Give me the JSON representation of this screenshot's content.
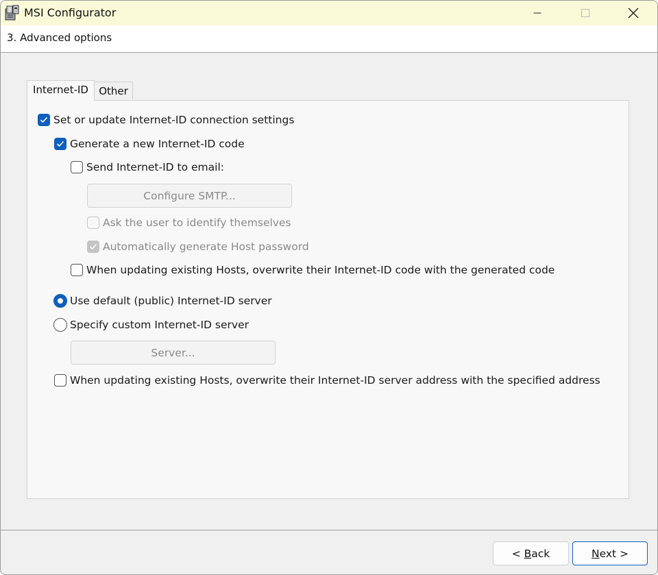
{
  "window": {
    "title": "MSI Configurator",
    "icon": "installer-box-icon"
  },
  "header": {
    "step_title": "3. Advanced options"
  },
  "tabs": [
    {
      "label": "Internet-ID",
      "active": true
    },
    {
      "label": "Other",
      "active": false
    }
  ],
  "internet_id": {
    "set_or_update": {
      "label": "Set or update Internet-ID connection settings",
      "checked": true
    },
    "generate_code": {
      "label": "Generate a new Internet-ID code",
      "checked": true
    },
    "send_email": {
      "label": "Send Internet-ID to email:",
      "checked": false
    },
    "configure_smtp": {
      "label": "Configure SMTP...",
      "enabled": false
    },
    "ask_identify": {
      "label": "Ask the user to identify themselves",
      "checked": false,
      "enabled": false
    },
    "auto_password": {
      "label": "Automatically generate Host password",
      "checked": true,
      "enabled": false
    },
    "overwrite_code": {
      "label": "When updating existing Hosts, overwrite their Internet-ID code with the generated code",
      "checked": false
    },
    "server_mode": {
      "default_label": "Use default (public) Internet-ID server",
      "custom_label": "Specify custom Internet-ID server",
      "selected": "default"
    },
    "server_button": {
      "label": "Server...",
      "enabled": false
    },
    "overwrite_server": {
      "label": "When updating existing Hosts, overwrite their Internet-ID server address with the specified address",
      "checked": false
    }
  },
  "footer": {
    "back_prefix": "< ",
    "back_mnemonic": "B",
    "back_rest": "ack",
    "next_mnemonic": "N",
    "next_rest": "ext >"
  },
  "colors": {
    "titlebar": "#fafad9",
    "accent": "#0f5fbd"
  }
}
